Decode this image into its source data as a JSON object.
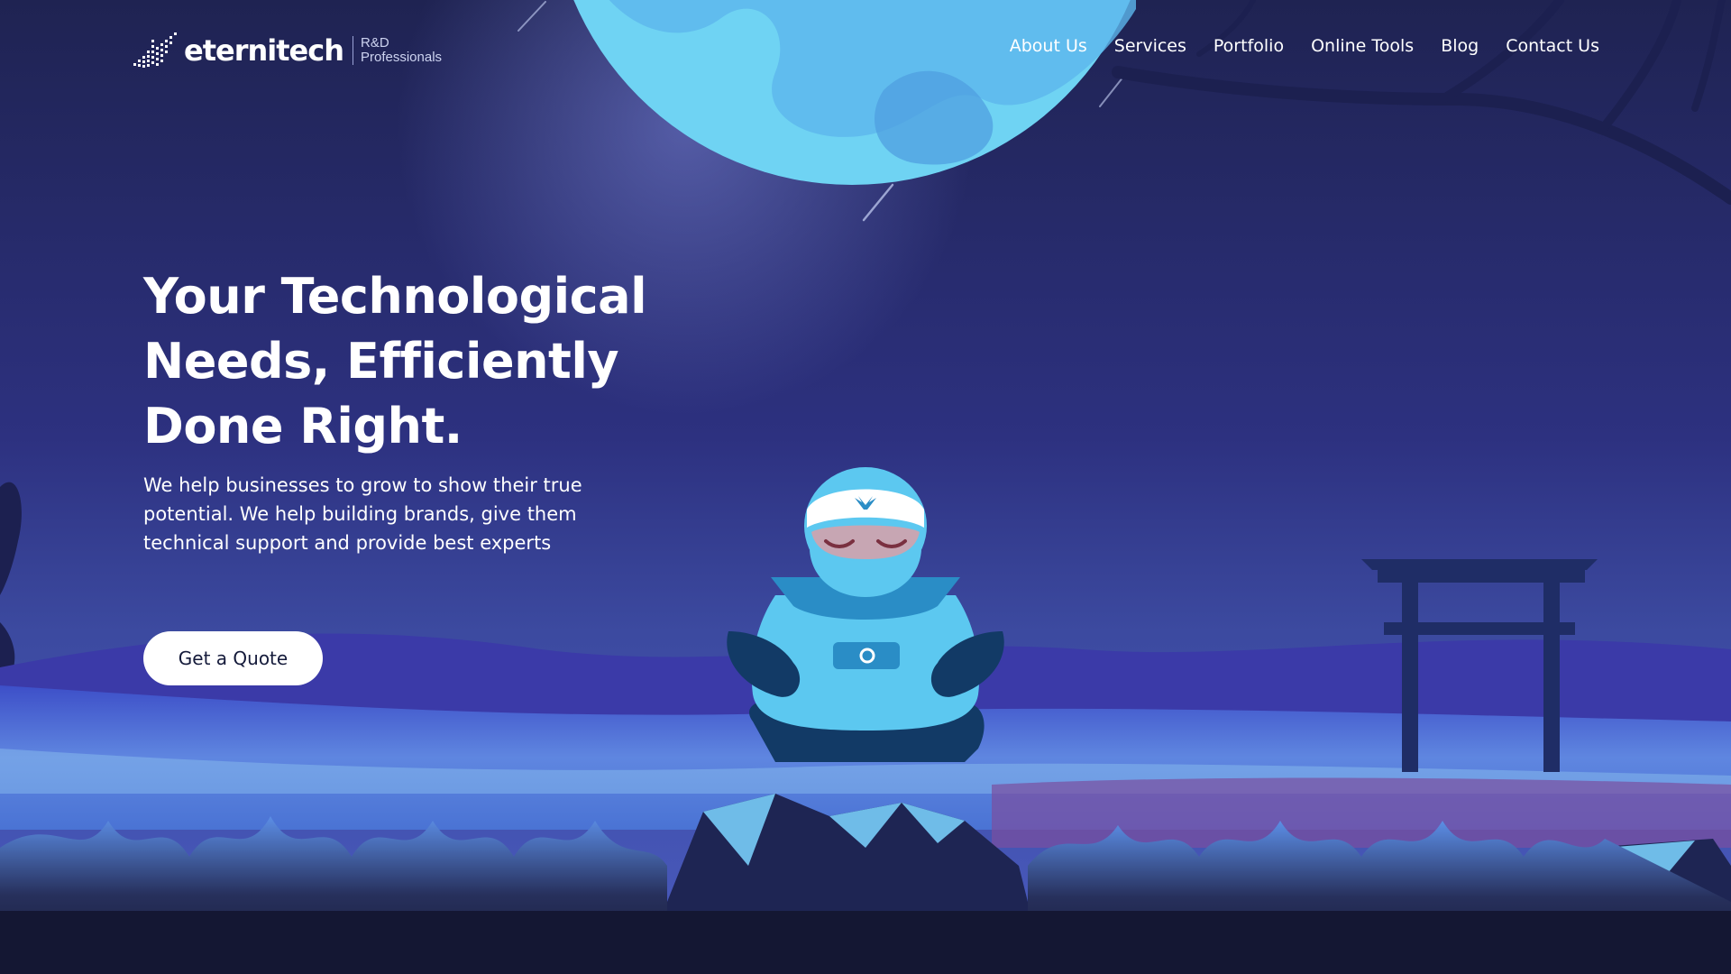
{
  "brand": {
    "name": "eternitech",
    "tagline_line1": "R&D",
    "tagline_line2": "Professionals"
  },
  "nav": {
    "items": [
      {
        "label": "About Us"
      },
      {
        "label": "Services"
      },
      {
        "label": "Portfolio"
      },
      {
        "label": "Online Tools"
      },
      {
        "label": "Blog"
      },
      {
        "label": "Contact Us"
      }
    ]
  },
  "hero": {
    "title": "Your Technological Needs, Efficiently Done Right.",
    "subtitle": "We help businesses to grow to show their true potential. We help building brands, give them technical support and provide best experts",
    "cta_label": "Get a Quote"
  },
  "colors": {
    "sky_top": "#1f2350",
    "sky_mid": "#3a3f9a",
    "moon": "#6fd3f3",
    "ninja": "#5cc8f0",
    "ninja_dark": "#123a66",
    "ground": "#171a3c",
    "button_bg": "#ffffff",
    "button_text": "#141a3a"
  },
  "icons": {
    "logo": "bird-pixel-logo-icon",
    "headband": "bird-icon",
    "belt": "gear-icon"
  }
}
